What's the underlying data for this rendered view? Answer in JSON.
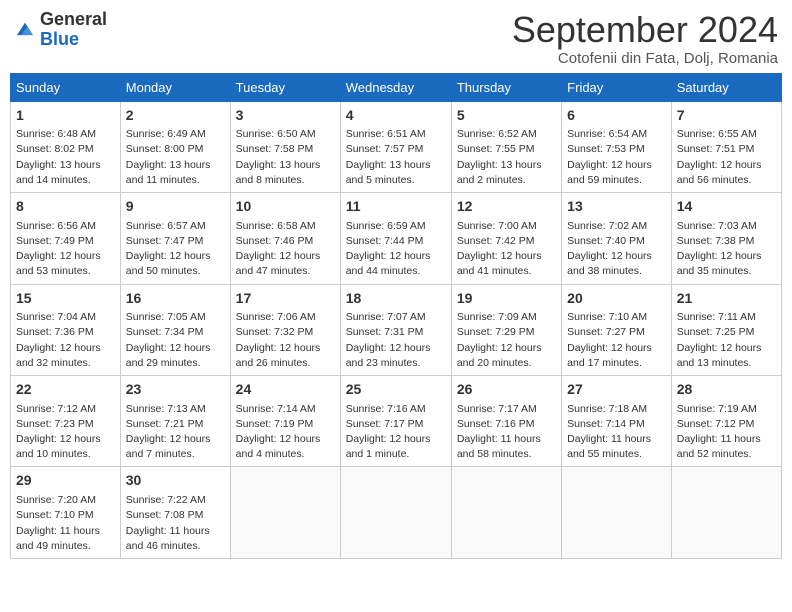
{
  "header": {
    "logo_general": "General",
    "logo_blue": "Blue",
    "month_year": "September 2024",
    "location": "Cotofenii din Fata, Dolj, Romania"
  },
  "weekdays": [
    "Sunday",
    "Monday",
    "Tuesday",
    "Wednesday",
    "Thursday",
    "Friday",
    "Saturday"
  ],
  "weeks": [
    [
      {
        "day": "1",
        "lines": [
          "Sunrise: 6:48 AM",
          "Sunset: 8:02 PM",
          "Daylight: 13 hours",
          "and 14 minutes."
        ]
      },
      {
        "day": "2",
        "lines": [
          "Sunrise: 6:49 AM",
          "Sunset: 8:00 PM",
          "Daylight: 13 hours",
          "and 11 minutes."
        ]
      },
      {
        "day": "3",
        "lines": [
          "Sunrise: 6:50 AM",
          "Sunset: 7:58 PM",
          "Daylight: 13 hours",
          "and 8 minutes."
        ]
      },
      {
        "day": "4",
        "lines": [
          "Sunrise: 6:51 AM",
          "Sunset: 7:57 PM",
          "Daylight: 13 hours",
          "and 5 minutes."
        ]
      },
      {
        "day": "5",
        "lines": [
          "Sunrise: 6:52 AM",
          "Sunset: 7:55 PM",
          "Daylight: 13 hours",
          "and 2 minutes."
        ]
      },
      {
        "day": "6",
        "lines": [
          "Sunrise: 6:54 AM",
          "Sunset: 7:53 PM",
          "Daylight: 12 hours",
          "and 59 minutes."
        ]
      },
      {
        "day": "7",
        "lines": [
          "Sunrise: 6:55 AM",
          "Sunset: 7:51 PM",
          "Daylight: 12 hours",
          "and 56 minutes."
        ]
      }
    ],
    [
      {
        "day": "8",
        "lines": [
          "Sunrise: 6:56 AM",
          "Sunset: 7:49 PM",
          "Daylight: 12 hours",
          "and 53 minutes."
        ]
      },
      {
        "day": "9",
        "lines": [
          "Sunrise: 6:57 AM",
          "Sunset: 7:47 PM",
          "Daylight: 12 hours",
          "and 50 minutes."
        ]
      },
      {
        "day": "10",
        "lines": [
          "Sunrise: 6:58 AM",
          "Sunset: 7:46 PM",
          "Daylight: 12 hours",
          "and 47 minutes."
        ]
      },
      {
        "day": "11",
        "lines": [
          "Sunrise: 6:59 AM",
          "Sunset: 7:44 PM",
          "Daylight: 12 hours",
          "and 44 minutes."
        ]
      },
      {
        "day": "12",
        "lines": [
          "Sunrise: 7:00 AM",
          "Sunset: 7:42 PM",
          "Daylight: 12 hours",
          "and 41 minutes."
        ]
      },
      {
        "day": "13",
        "lines": [
          "Sunrise: 7:02 AM",
          "Sunset: 7:40 PM",
          "Daylight: 12 hours",
          "and 38 minutes."
        ]
      },
      {
        "day": "14",
        "lines": [
          "Sunrise: 7:03 AM",
          "Sunset: 7:38 PM",
          "Daylight: 12 hours",
          "and 35 minutes."
        ]
      }
    ],
    [
      {
        "day": "15",
        "lines": [
          "Sunrise: 7:04 AM",
          "Sunset: 7:36 PM",
          "Daylight: 12 hours",
          "and 32 minutes."
        ]
      },
      {
        "day": "16",
        "lines": [
          "Sunrise: 7:05 AM",
          "Sunset: 7:34 PM",
          "Daylight: 12 hours",
          "and 29 minutes."
        ]
      },
      {
        "day": "17",
        "lines": [
          "Sunrise: 7:06 AM",
          "Sunset: 7:32 PM",
          "Daylight: 12 hours",
          "and 26 minutes."
        ]
      },
      {
        "day": "18",
        "lines": [
          "Sunrise: 7:07 AM",
          "Sunset: 7:31 PM",
          "Daylight: 12 hours",
          "and 23 minutes."
        ]
      },
      {
        "day": "19",
        "lines": [
          "Sunrise: 7:09 AM",
          "Sunset: 7:29 PM",
          "Daylight: 12 hours",
          "and 20 minutes."
        ]
      },
      {
        "day": "20",
        "lines": [
          "Sunrise: 7:10 AM",
          "Sunset: 7:27 PM",
          "Daylight: 12 hours",
          "and 17 minutes."
        ]
      },
      {
        "day": "21",
        "lines": [
          "Sunrise: 7:11 AM",
          "Sunset: 7:25 PM",
          "Daylight: 12 hours",
          "and 13 minutes."
        ]
      }
    ],
    [
      {
        "day": "22",
        "lines": [
          "Sunrise: 7:12 AM",
          "Sunset: 7:23 PM",
          "Daylight: 12 hours",
          "and 10 minutes."
        ]
      },
      {
        "day": "23",
        "lines": [
          "Sunrise: 7:13 AM",
          "Sunset: 7:21 PM",
          "Daylight: 12 hours",
          "and 7 minutes."
        ]
      },
      {
        "day": "24",
        "lines": [
          "Sunrise: 7:14 AM",
          "Sunset: 7:19 PM",
          "Daylight: 12 hours",
          "and 4 minutes."
        ]
      },
      {
        "day": "25",
        "lines": [
          "Sunrise: 7:16 AM",
          "Sunset: 7:17 PM",
          "Daylight: 12 hours",
          "and 1 minute."
        ]
      },
      {
        "day": "26",
        "lines": [
          "Sunrise: 7:17 AM",
          "Sunset: 7:16 PM",
          "Daylight: 11 hours",
          "and 58 minutes."
        ]
      },
      {
        "day": "27",
        "lines": [
          "Sunrise: 7:18 AM",
          "Sunset: 7:14 PM",
          "Daylight: 11 hours",
          "and 55 minutes."
        ]
      },
      {
        "day": "28",
        "lines": [
          "Sunrise: 7:19 AM",
          "Sunset: 7:12 PM",
          "Daylight: 11 hours",
          "and 52 minutes."
        ]
      }
    ],
    [
      {
        "day": "29",
        "lines": [
          "Sunrise: 7:20 AM",
          "Sunset: 7:10 PM",
          "Daylight: 11 hours",
          "and 49 minutes."
        ]
      },
      {
        "day": "30",
        "lines": [
          "Sunrise: 7:22 AM",
          "Sunset: 7:08 PM",
          "Daylight: 11 hours",
          "and 46 minutes."
        ]
      },
      null,
      null,
      null,
      null,
      null
    ]
  ]
}
